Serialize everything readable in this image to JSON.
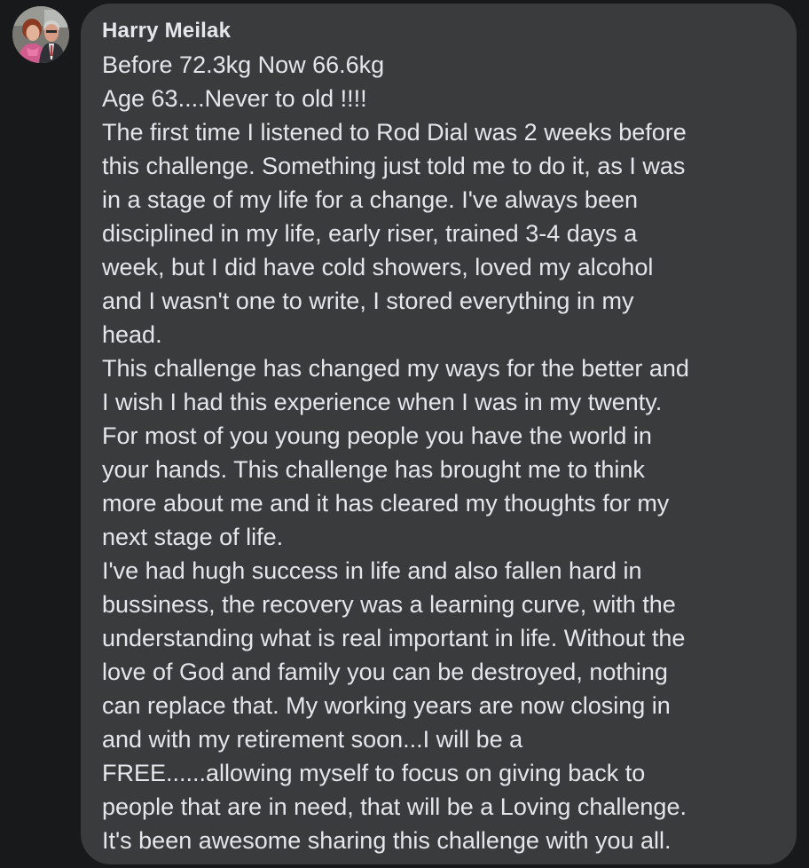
{
  "comment": {
    "author": "Harry Meilak",
    "lines": [
      "Before 72.3kg Now 66.6kg",
      "Age 63....Never to old !!!!",
      "The first time I listened to Rod Dial was 2 weeks before",
      "this challenge. Something just told me to do it, as I was",
      "in a stage of my life for a change. I've always been",
      "disciplined in my life, early riser, trained 3-4 days a",
      "week, but I did have cold showers, loved my alcohol",
      "and I wasn't one to write, I stored everything in my",
      "head.",
      "This challenge has changed my ways for the better and",
      "I wish I had this experience when I was in my twenty.",
      "For most of you young people you have the world in",
      "your hands. This challenge has brought me to think",
      "more about me and it has cleared my thoughts for my",
      "next stage of life.",
      "I've had hugh success in life and also fallen hard in",
      "bussiness, the recovery was a learning curve, with the",
      "understanding what is real important in life. Without the",
      "love of God and family you can be destroyed, nothing",
      "can replace that. My working years are now closing in",
      "and with my retirement soon...I will be a",
      "FREE......allowing myself to focus on giving back to",
      "people that are in need, that will be a Loving challenge.",
      "It's been awesome sharing this challenge with you all."
    ]
  },
  "colors": {
    "background": "#18191a",
    "bubble": "#3a3b3c",
    "text": "#e4e6eb"
  }
}
